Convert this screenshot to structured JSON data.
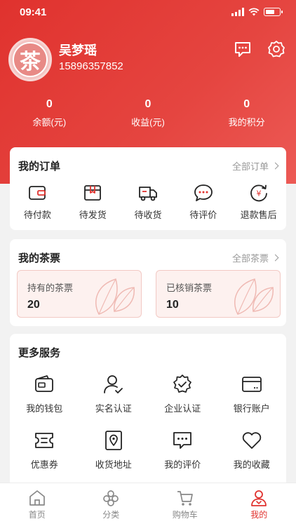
{
  "status": {
    "time": "09:41"
  },
  "user": {
    "name": "吴梦瑶",
    "phone": "15896357852",
    "avatar_char": "茶"
  },
  "stats": [
    {
      "value": "0",
      "label": "余额(元)"
    },
    {
      "value": "0",
      "label": "收益(元)"
    },
    {
      "value": "0",
      "label": "我的积分"
    }
  ],
  "orders": {
    "title": "我的订单",
    "more": "全部订单",
    "items": [
      {
        "label": "待付款",
        "icon": "wallet-icon"
      },
      {
        "label": "待发货",
        "icon": "box-icon"
      },
      {
        "label": "待收货",
        "icon": "truck-icon"
      },
      {
        "label": "待评价",
        "icon": "comment-icon"
      },
      {
        "label": "退款售后",
        "icon": "refund-icon"
      }
    ]
  },
  "tickets": {
    "title": "我的茶票",
    "more": "全部茶票",
    "held": {
      "label": "持有的茶票",
      "value": "20"
    },
    "used": {
      "label": "已核销茶票",
      "value": "10"
    }
  },
  "services": {
    "title": "更多服务",
    "items": [
      {
        "label": "我的钱包",
        "icon": "wallet-icon"
      },
      {
        "label": "实名认证",
        "icon": "user-check-icon"
      },
      {
        "label": "企业认证",
        "icon": "badge-check-icon"
      },
      {
        "label": "银行账户",
        "icon": "bank-card-icon"
      },
      {
        "label": "优惠券",
        "icon": "coupon-icon"
      },
      {
        "label": "收货地址",
        "icon": "location-icon"
      },
      {
        "label": "我的评价",
        "icon": "comment-icon"
      },
      {
        "label": "我的收藏",
        "icon": "heart-icon"
      }
    ]
  },
  "tabbar": {
    "items": [
      {
        "label": "首页",
        "icon": "home-icon"
      },
      {
        "label": "分类",
        "icon": "category-icon"
      },
      {
        "label": "购物车",
        "icon": "cart-icon"
      },
      {
        "label": "我的",
        "icon": "user-icon",
        "active": true
      }
    ]
  },
  "colors": {
    "brand": "#e0322e",
    "ticket_bg": "#fdf1ef"
  }
}
